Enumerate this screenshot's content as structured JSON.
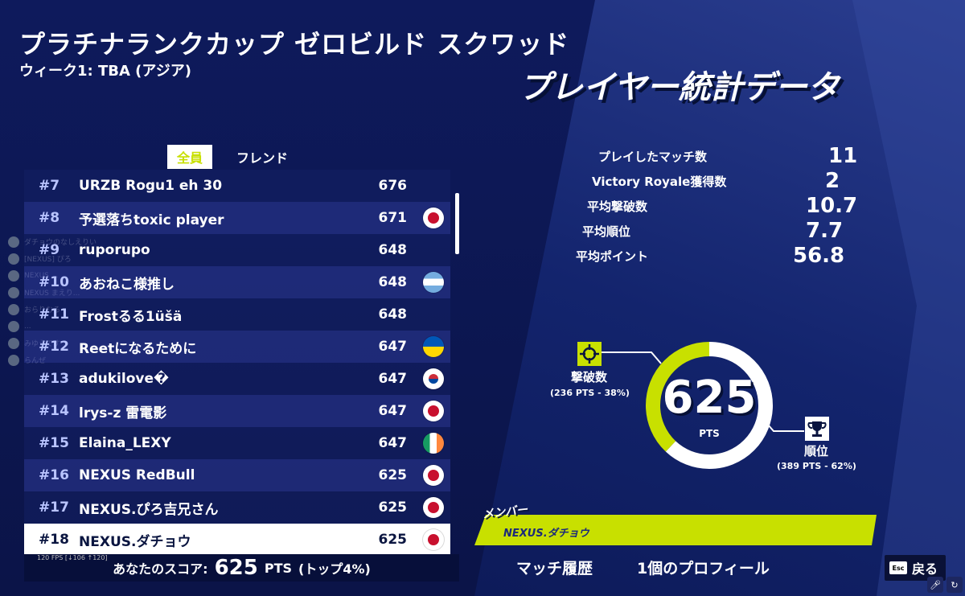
{
  "header": {
    "title": "プラチナランクカップ ゼロビルド スクワッド",
    "subtitle": "ウィーク1: TBA (アジア)",
    "panel_heading": "プレイヤー統計データ"
  },
  "tabs": [
    {
      "label": "全員",
      "active": true
    },
    {
      "label": "フレンド",
      "active": false
    }
  ],
  "leaderboard": [
    {
      "rank": "#7",
      "name": "URZB Rogu1 eh 30",
      "score": "676",
      "flag": ""
    },
    {
      "rank": "#8",
      "name": "予選落ちtoxic player",
      "score": "671",
      "flag": "jp"
    },
    {
      "rank": "#9",
      "name": "ruporupo",
      "score": "648",
      "flag": ""
    },
    {
      "rank": "#10",
      "name": "あおねこ様推し",
      "score": "648",
      "flag": "ar"
    },
    {
      "rank": "#11",
      "name": "Frostるる1üšä",
      "score": "648",
      "flag": ""
    },
    {
      "rank": "#12",
      "name": "Reetになるために",
      "score": "647",
      "flag": "ua"
    },
    {
      "rank": "#13",
      "name": "adukilove�",
      "score": "647",
      "flag": "kr"
    },
    {
      "rank": "#14",
      "name": "lrys-z 雷電影",
      "score": "647",
      "flag": "jp"
    },
    {
      "rank": "#15",
      "name": "Elaina_LEXY",
      "score": "647",
      "flag": "ie"
    },
    {
      "rank": "#16",
      "name": "NEXUS RedBull",
      "score": "625",
      "flag": "jp"
    },
    {
      "rank": "#17",
      "name": "NEXUS.ぴろ吉兄さん",
      "score": "625",
      "flag": "jp"
    },
    {
      "rank": "#18",
      "name": "NEXUS.ダチョウ",
      "score": "625",
      "flag": "jp",
      "me": true
    }
  ],
  "your_score": {
    "label": "あなたのスコア:",
    "value": "625",
    "unit": "PTS",
    "rank_note": "(トップ4%)"
  },
  "fps_overlay": "120 FPS [↓106 ↑120]",
  "stats": [
    {
      "label": "プレイしたマッチ数",
      "value": "11"
    },
    {
      "label": "Victory Royale獲得数",
      "value": "2"
    },
    {
      "label": "平均撃破数",
      "value": "10.7"
    },
    {
      "label": "平均順位",
      "value": "7.7"
    },
    {
      "label": "平均ポイント",
      "value": "56.8"
    }
  ],
  "donut": {
    "total": "625",
    "unit": "PTS",
    "elimination_fraction": 0.38,
    "placement_fraction": 0.62,
    "elim_label": "撃破数",
    "elim_detail": "(236 PTS - 38%)",
    "place_label": "順位",
    "place_detail": "(389 PTS - 62%)",
    "elim_color": "#c8e000",
    "place_color": "#ffffff"
  },
  "member": {
    "tag": "メンバー",
    "name": "NEXUS.ダチョウ"
  },
  "footer": {
    "match_history": "マッチ履歴",
    "profile": "1個のプロフィール",
    "back_key": "Esc",
    "back_label": "戻る"
  },
  "chat_overlay": [
    {
      "text": "ダチョウのなしえりい"
    },
    {
      "text": "[NEXUS] ぴろ"
    },
    {
      "text": "NEXUS ..."
    },
    {
      "text": "NEXUS まえり..."
    },
    {
      "text": "おらりむる"
    },
    {
      "text": "..."
    },
    {
      "text": "みゆうです"
    },
    {
      "text": "らんぜ"
    }
  ],
  "colors": {
    "accent": "#c8e000",
    "background": "#0c1650"
  }
}
